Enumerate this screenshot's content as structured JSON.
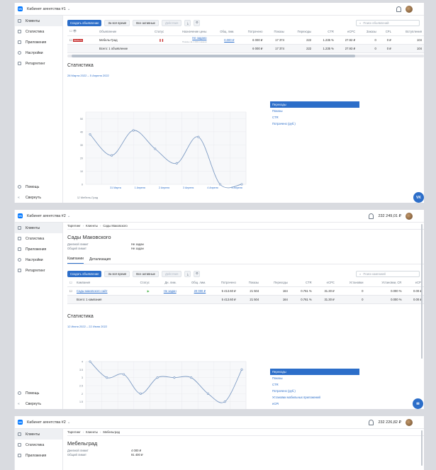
{
  "accent": "#2c6ec9",
  "shot1": {
    "cabinet": "Кабинет агентства #1",
    "sidebar": [
      "Клиенты",
      "Статистика",
      "Приложения",
      "Настройки",
      "Ретаргетинг"
    ],
    "help": "Помощь",
    "collapse": "Свернуть",
    "toolbar": {
      "create": "Создать объявление",
      "time": "За всё время",
      "filter": "Все активные",
      "actions": "Действия"
    },
    "search_placeholder": "Поиск объявлений",
    "table": {
      "headers": [
        "Объявление",
        "Статус",
        "Назначение цены",
        "Общ. лим.",
        "Потрачено",
        "Показы",
        "Переходы",
        "CTR",
        "eCPC",
        "Заказы",
        "CPL",
        "Вступления"
      ],
      "row": {
        "name": "Мебель-Град",
        "price": "Не задано",
        "price_sub": "Показы за 1 000 показов",
        "limit": "0.000 ₽",
        "spent": "6 000 ₽",
        "shows": "17 374",
        "clicks": "222",
        "ctr": "1.235 %",
        "ecpc": "27.92 ₽",
        "orders": "0",
        "cpl": "0 ₽",
        "joins": "104"
      },
      "total": {
        "label": "Всего: 1 объявление",
        "spent": "6 000 ₽",
        "shows": "17 374",
        "clicks": "222",
        "ctr": "1.235 %",
        "ecpc": "27.93 ₽",
        "orders": "0",
        "cpl": "0 ₽",
        "joins": "104"
      }
    },
    "stats_title": "Статистика",
    "range": "28 Марта 2022 – 5 Апреля 2022",
    "legend": [
      "Переходы",
      "Показы",
      "CTR",
      "Потрачено (руб.)"
    ],
    "chart_item": "Мебель-Град"
  },
  "chart_data": [
    {
      "type": "line",
      "x": [
        "31 Марта",
        "1 Апреля",
        "2 Апреля",
        "3 Апреля",
        "4 Апреля",
        "5 Апреля"
      ],
      "y_ticks": [
        0,
        10,
        20,
        30,
        40,
        50
      ],
      "values": [
        38,
        22,
        41,
        27,
        16,
        36,
        0,
        0
      ],
      "ylim": [
        0,
        55
      ]
    },
    {
      "type": "line",
      "y_ticks": [
        1,
        1.5,
        2,
        2.5,
        3,
        3.5,
        4
      ],
      "values": [
        4,
        3,
        3.2,
        2,
        3,
        3,
        3,
        2,
        1.5,
        3.5
      ],
      "ylim": [
        1,
        4
      ]
    }
  ],
  "shot2": {
    "cabinet": "Кабинет агентства #2",
    "balance": "232 249,01 ₽",
    "sidebar": [
      "Клиенты",
      "Статистика",
      "Приложения",
      "Настройки",
      "Ретаргетинг"
    ],
    "help": "Помощь",
    "collapse": "Свернуть",
    "crumbs": [
      "Таргетинг",
      "Клиенты",
      "Сады Маковского"
    ],
    "title": "Сады Маковского",
    "kv": [
      [
        "Дневной лимит",
        "Не задан"
      ],
      [
        "Общий лимит",
        "Не задан"
      ]
    ],
    "tabs": [
      "Кампании",
      "Детализация"
    ],
    "toolbar": {
      "create": "Создать объявление",
      "time": "За всё время",
      "filter": "Все активные",
      "actions": "Действия"
    },
    "search_placeholder": "Поиск кампаний",
    "table": {
      "headers": [
        "Кампания",
        "Статус",
        "Дн. лим.",
        "Общ. лим.",
        "Потрачено",
        "Показы",
        "Переходы",
        "CTR",
        "eCPC",
        "Установки",
        "Установки, CR",
        "eCPI"
      ],
      "row": {
        "name": "Сады маковского сайт",
        "day": "Не задан",
        "limit": "20 000 ₽",
        "spent": "5 413.60 ₽",
        "shows": "21 504",
        "clicks": "164",
        "ctr": "0.761 %",
        "ecpc": "31.30 ₽",
        "inst": "0",
        "cr": "0.000 %",
        "ecpi": "0.00 ₽"
      },
      "total": {
        "label": "Всего: 1 кампания",
        "spent": "5 413.60 ₽",
        "shows": "21 504",
        "clicks": "164",
        "ctr": "0.761 %",
        "ecpc": "31.30 ₽",
        "inst": "0",
        "cr": "0.000 %",
        "ecpi": "0.00 ₽"
      }
    },
    "stats_title": "Статистика",
    "range": "12 Июня 2022 – 22 Июня 2022",
    "legend": [
      "Переходы",
      "Показы",
      "CTR",
      "Потрачено (руб.)",
      "Установки мобильных приложений",
      "eCPI"
    ]
  },
  "shot3": {
    "cabinet": "Кабинет агентства #2",
    "balance": "232 226,82 ₽",
    "sidebar": [
      "Клиенты",
      "Статистика",
      "Приложения"
    ],
    "crumbs": [
      "Таргетинг",
      "Клиенты",
      "Мебельград"
    ],
    "title": "Мебельград",
    "kv": [
      [
        "Дневной лимит",
        "4 000 ₽"
      ],
      [
        "Общий лимит",
        "91 400 ₽"
      ]
    ]
  }
}
